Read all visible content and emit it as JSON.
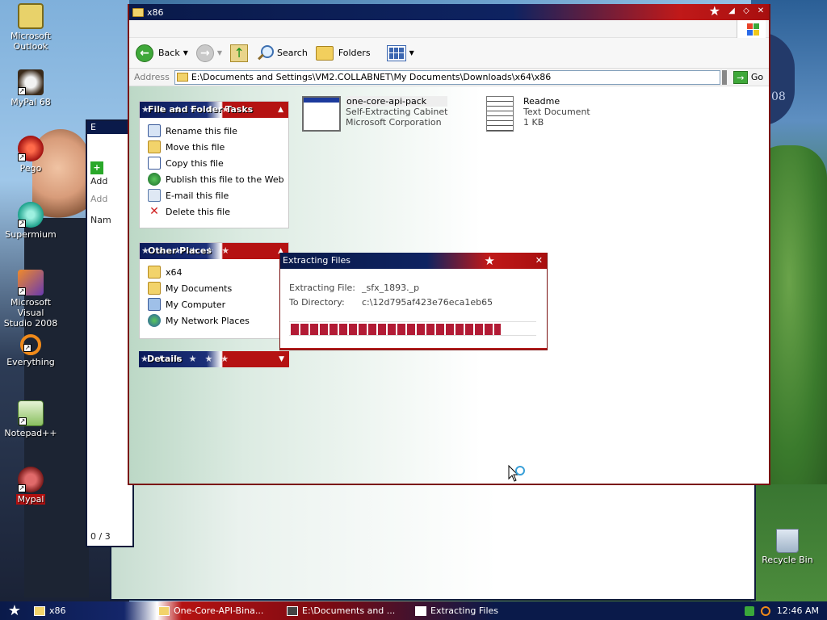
{
  "desktop": {
    "icons": [
      {
        "label": "Microsoft Outlook",
        "icon": "outlook-icon"
      },
      {
        "label": "MyPal 68",
        "icon": "mypal-icon"
      },
      {
        "label": "Pego",
        "icon": "pego-icon"
      },
      {
        "label": "Supermium",
        "icon": "supermium-icon"
      },
      {
        "label": "Microsoft Visual Studio 2008",
        "icon": "visual-studio-icon"
      },
      {
        "label": "Everything",
        "icon": "everything-icon"
      },
      {
        "label": "Notepad++",
        "icon": "notepadpp-icon"
      },
      {
        "label": "Mypal",
        "icon": "mypal-red-icon"
      }
    ],
    "recycle_bin": "Recycle Bin",
    "seal_text": "08"
  },
  "bg_window": {
    "title": "E",
    "add_label": "Add",
    "addr_label": "Add",
    "name_col": "Nam",
    "status": "0 / 3"
  },
  "window": {
    "title": "x86",
    "toolbar": {
      "back": "Back",
      "search": "Search",
      "folders": "Folders"
    },
    "address": {
      "label": "Address",
      "path": "E:\\Documents and Settings\\VM2.COLLABNET\\My Documents\\Downloads\\x64\\x86",
      "go": "Go"
    },
    "tasks_panel": {
      "title": "File and Folder Tasks",
      "items": [
        "Rename this file",
        "Move this file",
        "Copy this file",
        "Publish this file to the Web",
        "E-mail this file",
        "Delete this file"
      ]
    },
    "places_panel": {
      "title": "Other Places",
      "items": [
        "x64",
        "My Documents",
        "My Computer",
        "My Network Places"
      ]
    },
    "details_panel": {
      "title": "Details"
    },
    "files": [
      {
        "name": "one-core-api-pack",
        "type": "Self-Extracting Cabinet",
        "extra": "Microsoft Corporation"
      },
      {
        "name": "Readme",
        "type": "Text Document",
        "extra": "1 KB"
      }
    ]
  },
  "dialog": {
    "title": "Extracting Files",
    "file_label": "Extracting File:",
    "file_value": "_sfx_1893._p",
    "dir_label": "To Directory:",
    "dir_value": "c:\\12d795af423e76eca1eb65",
    "progress": 0.86
  },
  "taskbar": {
    "tasks": [
      "x86",
      "One-Core-API-Bina...",
      "E:\\Documents and ...",
      "Extracting Files"
    ],
    "clock": "12:46 AM"
  },
  "colors": {
    "navy": "#0a1a4a",
    "red": "#b21b1b",
    "progress": "#b21b35"
  }
}
